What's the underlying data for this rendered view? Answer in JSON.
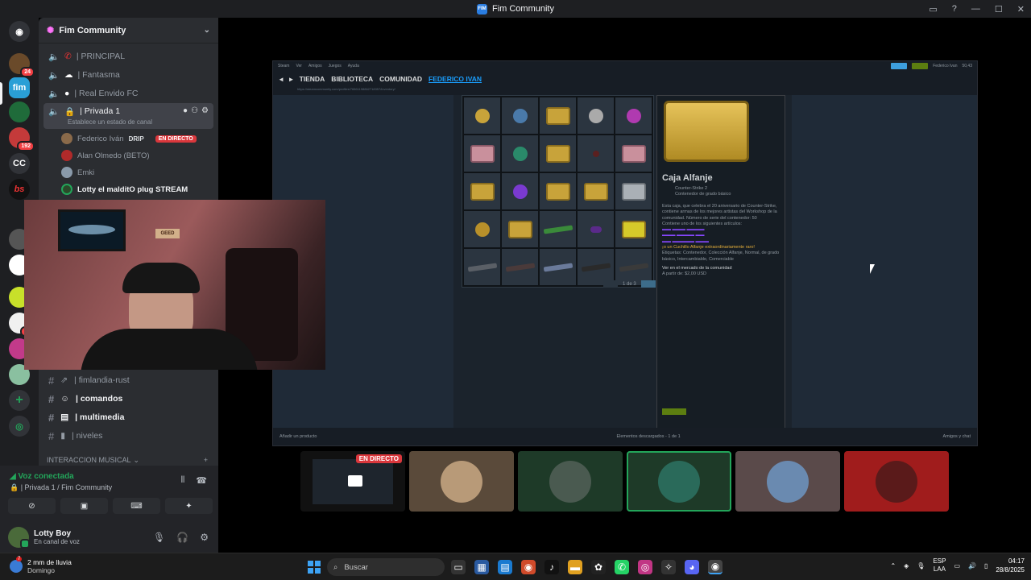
{
  "window": {
    "title": "Fim Community",
    "logo_text": "FIM"
  },
  "rail": {
    "badges": [
      "24",
      "192",
      "27"
    ],
    "cc_label": "CC"
  },
  "server": {
    "name": "Fim Community"
  },
  "voice_channels": [
    {
      "label": "| PRINCIPAL"
    },
    {
      "label": "|  Fantasma"
    },
    {
      "label": "| Real Envido FC"
    },
    {
      "label": "| Privada 1",
      "status": "Establece un estado de canal"
    }
  ],
  "voice_users": [
    {
      "name": "Federico Iván",
      "tag": "DRIP",
      "live": "EN DIRECTO"
    },
    {
      "name": "Alan Olmedo (BETO)"
    },
    {
      "name": "Emki"
    },
    {
      "name": "Lotty el malditO plug STREAM"
    }
  ],
  "text_channels": [
    {
      "label": "| fimlandia-rust"
    },
    {
      "label": "| comandos"
    },
    {
      "label": "| multimedia"
    },
    {
      "label": "| niveles"
    }
  ],
  "category": {
    "label": "INTERACCION MUSICAL",
    "plus": "+"
  },
  "voice_panel": {
    "title": "Voz conectada",
    "subtitle": "| Privada 1 / Fim Community"
  },
  "user": {
    "name": "Lotty Boy",
    "status": "En canal de voz"
  },
  "steam": {
    "menu": [
      "Steam",
      "Ver",
      "Amigos",
      "Juegos",
      "Ayuda"
    ],
    "user_label": "Federico Ivan",
    "balance": "50,43",
    "nav": [
      "TIENDA",
      "BIBLIOTECA",
      "COMUNIDAD",
      "FEDERICO IVAN"
    ],
    "url": "https://steamcommunity.com/profiles/76561198862718357/inventory/",
    "pager": "1 de 3",
    "item_title": "Caja Alfanje",
    "item_game": "Counter-Strike 2",
    "item_type": "Contenedor de grado básico",
    "item_desc": "Esta caja, que celebra el 20 aniversario de Counter-Strike, contiene armas de los mejores artistas del Workshop de la comunidad. Número de serie del contenedor: 50",
    "item_contains": "Contiene uno de los siguientes artículos:",
    "item_rare": "¡o un Cuchillo Alfanje extraordinariamente raro!",
    "item_tags": "Etiquetas: Contenedor, Colección Alfanje, Normal, de grado básico, Intercambiable, Comerciable",
    "market_label": "Ver en el mercado de la comunidad",
    "price": "A partir de: $2,00 USD",
    "footer_left": "Añadir un producto",
    "footer_mid": "Elementos descargados - 1 de 1",
    "footer_right": "Amigos y chat"
  },
  "webcam": {
    "sign": "GEED"
  },
  "tiles": {
    "live_label": "EN DIRECTO"
  },
  "taskbar": {
    "weather_temp": "2 mm de lluvia",
    "weather_day": "Domingo",
    "weather_badge": "7",
    "search_placeholder": "Buscar",
    "lang_top": "ESP",
    "lang_bottom": "LAA",
    "time": "04:17",
    "date": "28/8/2025"
  }
}
